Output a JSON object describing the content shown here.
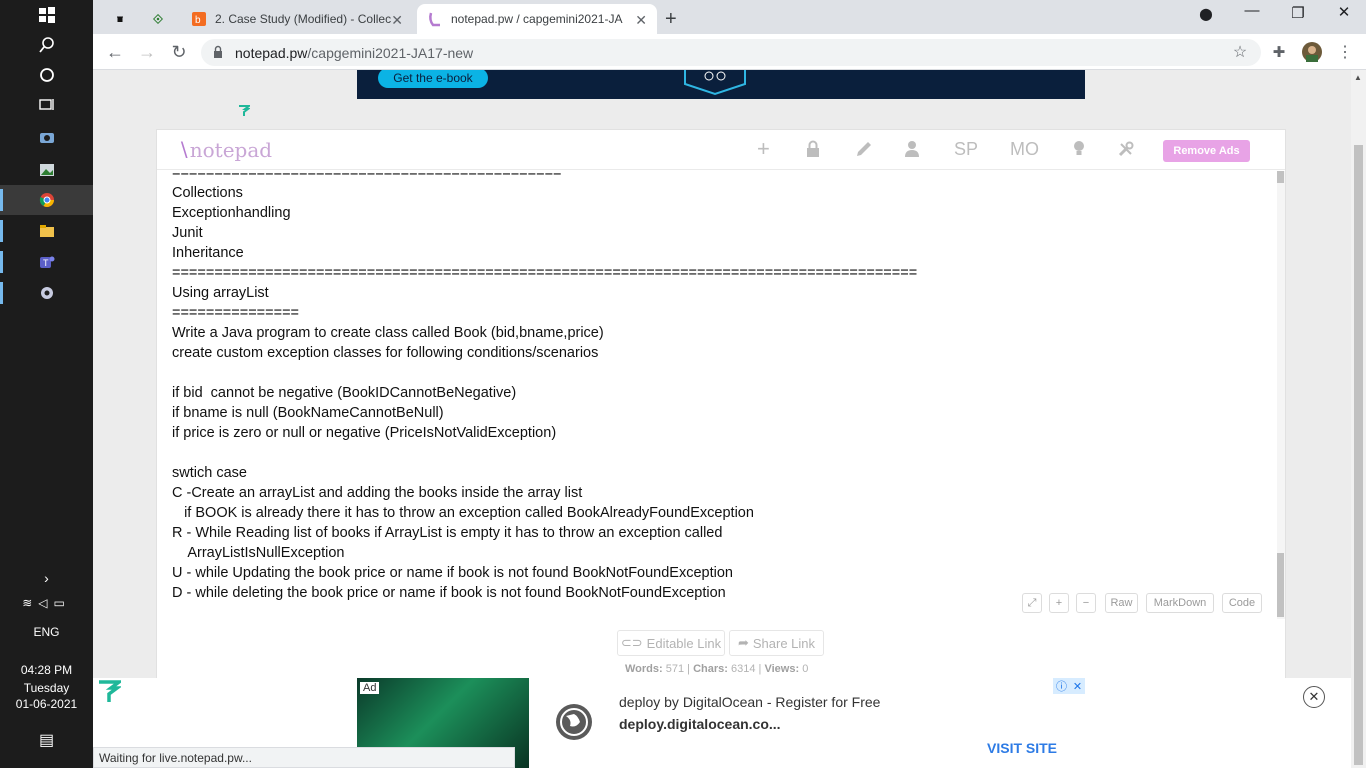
{
  "browser": {
    "tabs": [
      {
        "label": ""
      },
      {
        "label": ""
      },
      {
        "label": "2. Case Study (Modified) - Collec"
      },
      {
        "label": "notepad.pw / capgemini2021-JA"
      }
    ],
    "url_host": "notepad.pw",
    "url_path": "/capgemini2021-JA17-new",
    "status": "Waiting for live.notepad.pw..."
  },
  "taskbar": {
    "language": "ENG",
    "time": "04:28 PM",
    "day": "Tuesday",
    "date": "01-06-2021"
  },
  "top_ad": {
    "button": "Get the e-book"
  },
  "notepad": {
    "logo": "notepad",
    "toolbar_sp": "SP",
    "toolbar_mo": "MO",
    "remove_ads": "Remove Ads",
    "lines": [
      "==============================================",
      "Collections",
      "Exceptionhandling",
      "Junit",
      "Inheritance",
      "========================================================================================",
      "Using arrayList",
      "===============",
      "Write a Java program to create class called Book (bid,bname,price)",
      "create custom exception classes for following conditions/scenarios",
      "",
      "if bid  cannot be negative (BookIDCannotBeNegative)",
      "if bname is null (BookNameCannotBeNull)",
      "if price is zero or null or negative (PriceIsNotValidException)",
      "",
      "swtich case",
      "C -Create an arrayList and adding the books inside the array list",
      "   if BOOK is already there it has to throw an exception called BookAlreadyFoundException",
      "R - While Reading list of books if ArrayList is empty it has to throw an exception called",
      "    ArrayListIsNullException",
      "U - while Updating the book price or name if book is not found BookNotFoundException",
      "D - while deleting the book price or name if book is not found BookNotFoundException"
    ],
    "mini_buttons": {
      "raw": "Raw",
      "markdown": "MarkDown",
      "code": "Code"
    },
    "editable_link": "Editable Link",
    "share_link": "Share Link",
    "stats": {
      "words_label": "Words:",
      "words": "571",
      "chars_label": "Chars:",
      "chars": "6314",
      "views_label": "Views:",
      "views": "0"
    }
  },
  "bottom_ad": {
    "tag": "Ad",
    "title": "deploy by DigitalOcean - Register for Free",
    "url": "deploy.digitalocean.co...",
    "visit": "VISIT SITE"
  }
}
